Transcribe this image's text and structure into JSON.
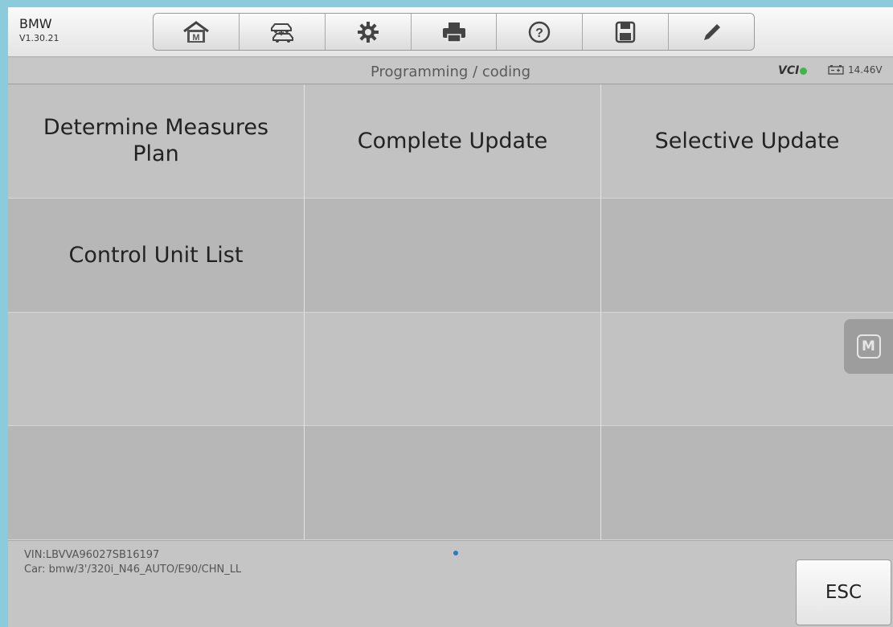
{
  "header": {
    "brand": "BMW",
    "version": "V1.30.21",
    "toolbar": [
      {
        "icon": "home-m-icon"
      },
      {
        "icon": "vehicle-swap-icon"
      },
      {
        "icon": "gear-icon"
      },
      {
        "icon": "printer-icon"
      },
      {
        "icon": "help-icon"
      },
      {
        "icon": "save-icon"
      },
      {
        "icon": "pen-icon"
      }
    ]
  },
  "subheader": {
    "title": "Programming / coding",
    "vci_label": "VCI",
    "battery_voltage": "14.46V"
  },
  "menu": {
    "items": [
      "Determine Measures Plan",
      "Complete Update",
      "Selective Update",
      "Control Unit List",
      "",
      "",
      "",
      "",
      "",
      "",
      "",
      ""
    ]
  },
  "float_button": {
    "label": "M"
  },
  "footer": {
    "vin": "VIN:LBVVA96027SB16197",
    "car": "Car: bmw/3'/320i_N46_AUTO/E90/CHN_LL",
    "esc_label": "ESC"
  },
  "colors": {
    "background": "#8ccbdc",
    "status_ok": "#3fb54a",
    "indicator_dot": "#2a78c8"
  }
}
